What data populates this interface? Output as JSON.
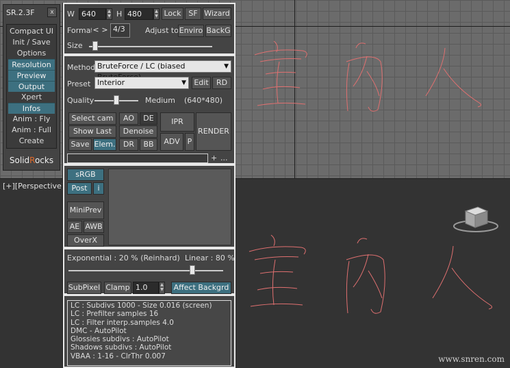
{
  "window": {
    "title": "SR.2.3F",
    "close_label": "x",
    "viewport_label": "[+][Perspective]",
    "watermark": "www.snren.com",
    "glyph_text": "室内人"
  },
  "menu": {
    "items": [
      {
        "label": "Compact UI",
        "active": false
      },
      {
        "label": "Init / Save",
        "active": false
      },
      {
        "label": "Options",
        "active": false
      },
      {
        "label": "Resolution",
        "active": true
      },
      {
        "label": "Preview",
        "active": true
      },
      {
        "label": "Output",
        "active": true
      },
      {
        "label": "Xpert",
        "active": false
      },
      {
        "label": "Infos",
        "active": true
      },
      {
        "label": "Anim : Fly",
        "active": false
      },
      {
        "label": "Anim : Full",
        "active": false
      },
      {
        "label": "Create",
        "active": false
      }
    ],
    "brand_prefix": "S",
    "brand_rest": "olid",
    "brand_accent": "R",
    "brand_tail": "ocks"
  },
  "resolution": {
    "w_label": "W",
    "width_value": "640",
    "h_label": "H",
    "height_value": "480",
    "lock": "Lock",
    "sf": "SF",
    "wizard": "Wizard",
    "format_label": "Format",
    "prev": "<",
    "next": ">",
    "format_value": "4/3",
    "adjust_label": "Adjust to",
    "enviro": "Enviro",
    "backg": "BackG",
    "size_label": "Size",
    "size_level": 0.05
  },
  "render": {
    "method_label": "Method",
    "method_value": "BruteForce / LC (biased BruteForce)",
    "preset_label": "Preset",
    "preset_value": "Interior",
    "edit": "Edit",
    "rd": "RD",
    "quality_label": "Quality",
    "quality_value": "Medium",
    "quality_res": "(640*480)",
    "quality_level": 0.5,
    "select_cam": "Select cam",
    "show_last": "Show Last",
    "save": "Save",
    "elem": "Elem.",
    "ao": "AO",
    "de": "DE",
    "denoise": "Denoise",
    "dr": "DR",
    "bb": "BB",
    "ipr": "IPR",
    "adv": "ADV",
    "p": "P",
    "render_btn": "RENDER",
    "plus": "+",
    "more": "..."
  },
  "preview": {
    "srgb": "sRGB",
    "post": "Post",
    "info_i": "i",
    "miniprev": "MiniPrev",
    "ae": "AE",
    "awb": "AWB",
    "overx": "OverX"
  },
  "color_mapping": {
    "exponential": "Exponential : 20 %  (Reinhard)",
    "linear": "Linear : 80 %",
    "mix_level": 0.8,
    "subpixel": "SubPixel",
    "clamp": "Clamp",
    "clamp_value": "1.0",
    "affect_backgrd": "Affect Backgrd"
  },
  "infos": {
    "lines": [
      "LC : Subdivs 1000 - Size 0.016 (screen)",
      "LC : Prefilter samples 16",
      "LC : Filter interp.samples  4.0",
      "DMC - AutoPilot",
      "Glossies subdivs : AutoPilot",
      "Shadows subdivs : AutoPilot",
      "VBAA : 1-16 - ClrThr 0.007"
    ]
  },
  "colors": {
    "accent_blue": "#3d7080",
    "brand_orange": "#e06a2a",
    "glyph_outline": "#e07070"
  }
}
